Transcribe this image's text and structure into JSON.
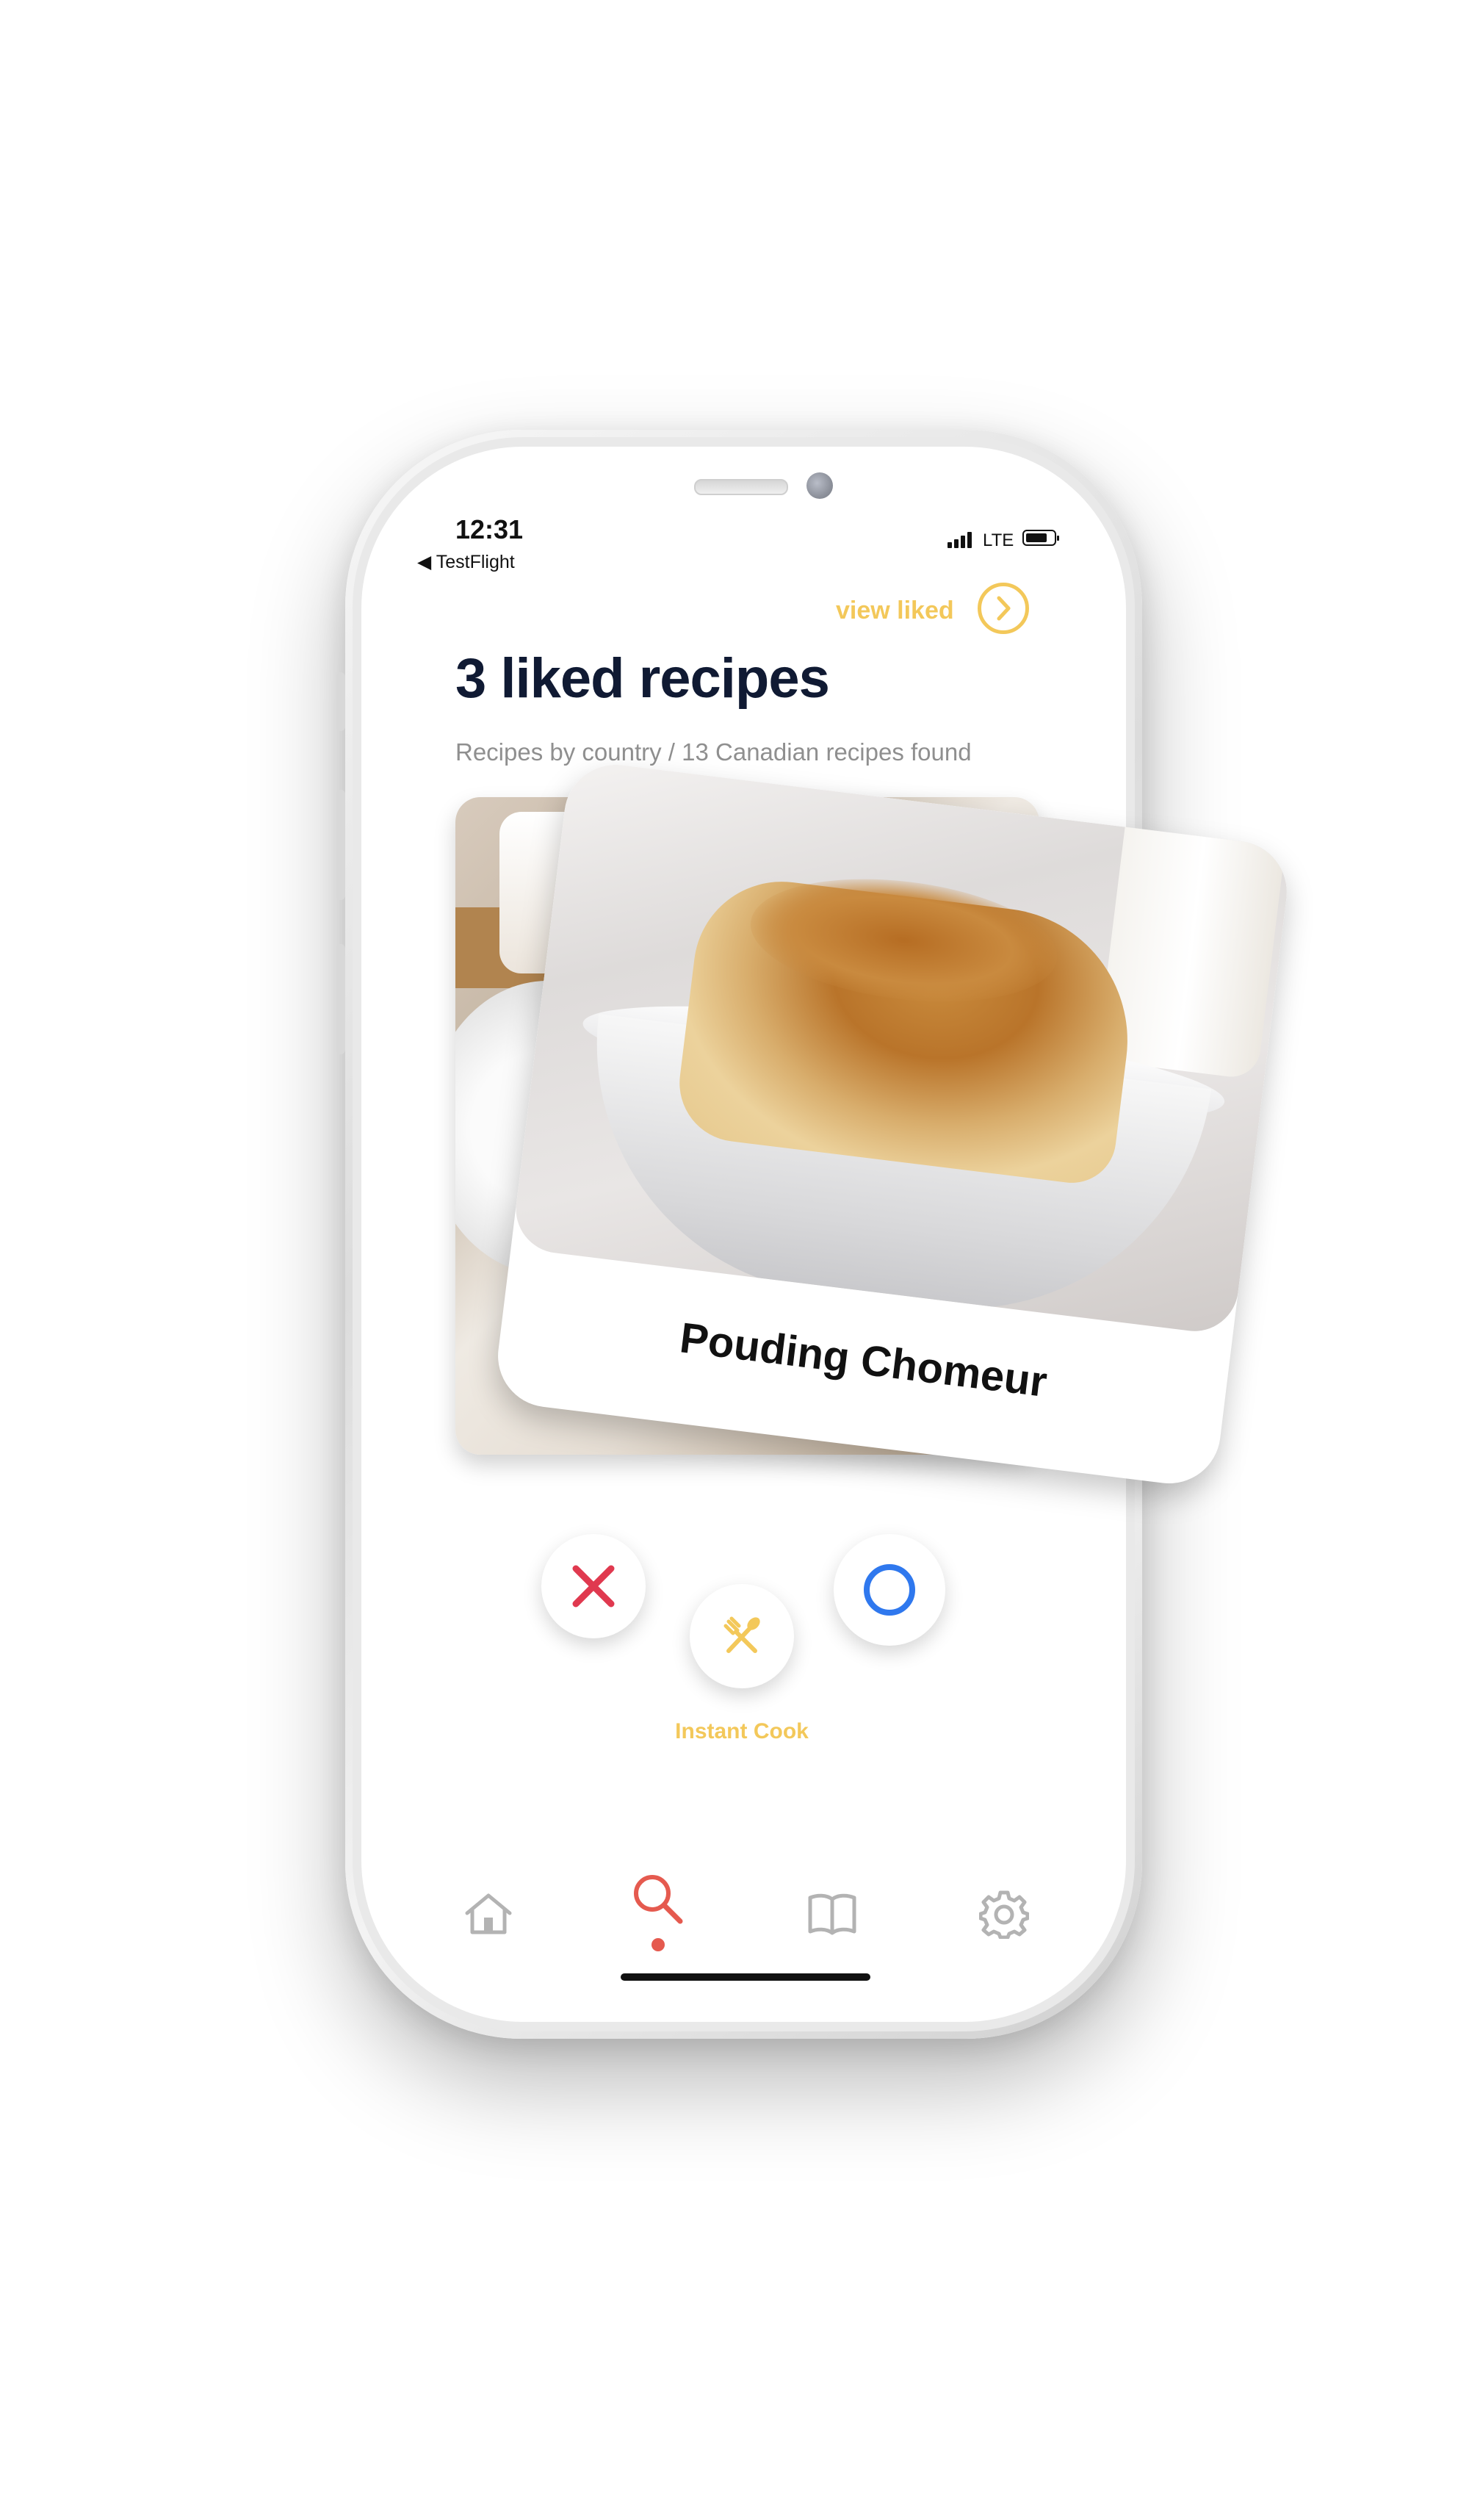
{
  "status_bar": {
    "time": "12:31",
    "back_app": "◀ TestFlight",
    "network": "LTE"
  },
  "header": {
    "view_liked_label": "view liked",
    "title": "3 liked recipes",
    "subtitle": "Recipes by country / 13 Canadian recipes found"
  },
  "card": {
    "title": "Pouding Chomeur"
  },
  "actions": {
    "instant_cook_label": "Instant Cook"
  },
  "colors": {
    "accent_yellow": "#f3c85a",
    "dislike_red": "#e0394f",
    "like_blue": "#2f78ee",
    "nav_active": "#e55a4f",
    "nav_inactive": "#b3b3b3",
    "title_navy": "#101a33"
  },
  "icons": {
    "view_liked": "chevron-right-icon",
    "dislike": "x-icon",
    "like": "circle-icon",
    "instant_cook": "utensils-icon",
    "nav": [
      "home-icon",
      "search-icon",
      "book-icon",
      "gear-icon"
    ]
  }
}
